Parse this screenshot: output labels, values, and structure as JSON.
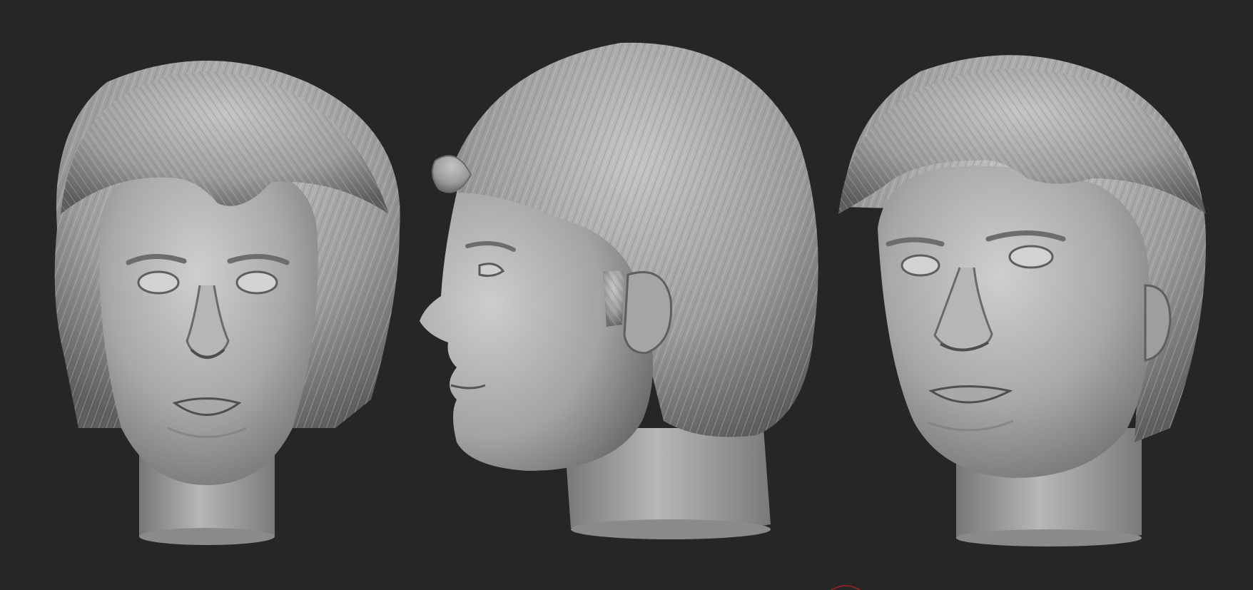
{
  "canvas": {
    "background": "#262626",
    "clay_light": "#c9c9c9",
    "clay_mid": "#9a9a9a",
    "clay_dark": "#5a5a5a"
  },
  "views": [
    {
      "name": "front-view",
      "orientation": "front"
    },
    {
      "name": "profile-view",
      "orientation": "left-profile"
    },
    {
      "name": "three-quarter-view",
      "orientation": "three-quarter"
    }
  ]
}
